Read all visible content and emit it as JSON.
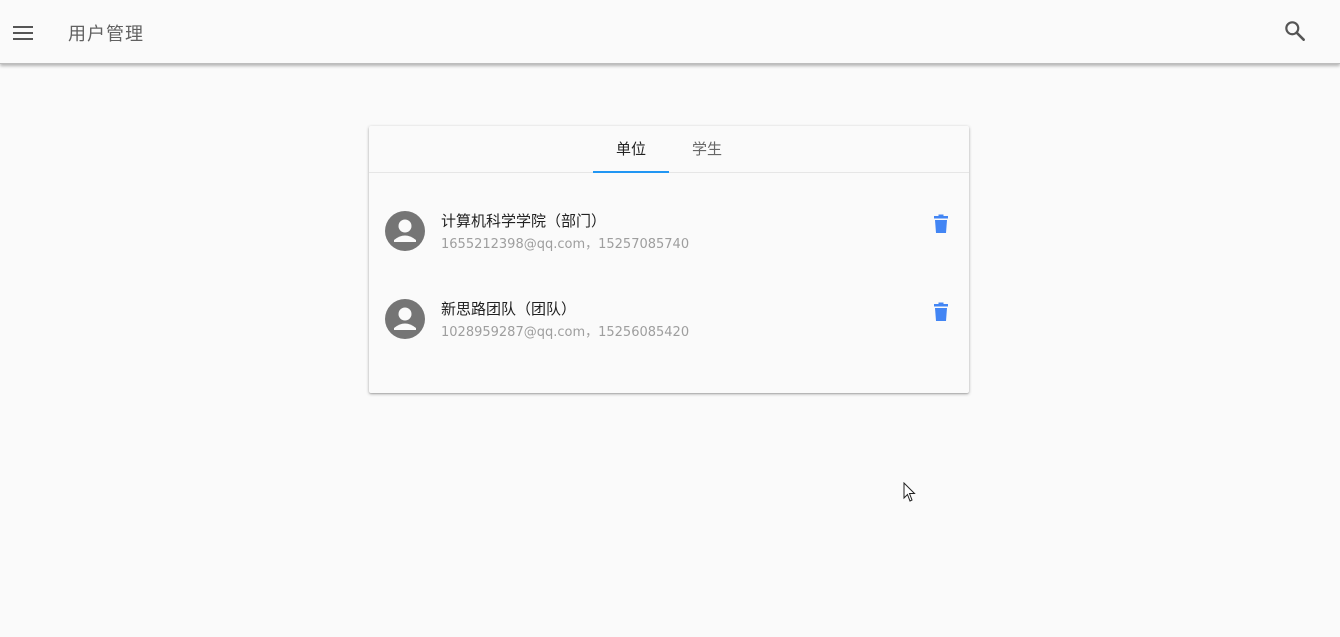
{
  "header": {
    "title": "用户管理",
    "menu_icon": "menu-icon",
    "search_icon": "search-icon"
  },
  "tabs": [
    {
      "label": "单位",
      "active": true
    },
    {
      "label": "学生",
      "active": false
    }
  ],
  "list": [
    {
      "title": "计算机科学学院（部门）",
      "subtitle": "1655212398@qq.com，15257085740",
      "avatar_icon": "account-circle-icon",
      "action_icon": "delete-icon"
    },
    {
      "title": "新思路团队（团队）",
      "subtitle": "1028959287@qq.com，15256085420",
      "avatar_icon": "account-circle-icon",
      "action_icon": "delete-icon"
    }
  ],
  "colors": {
    "accent": "#2196f3",
    "delete": "#4285f4",
    "avatar": "#757575"
  }
}
